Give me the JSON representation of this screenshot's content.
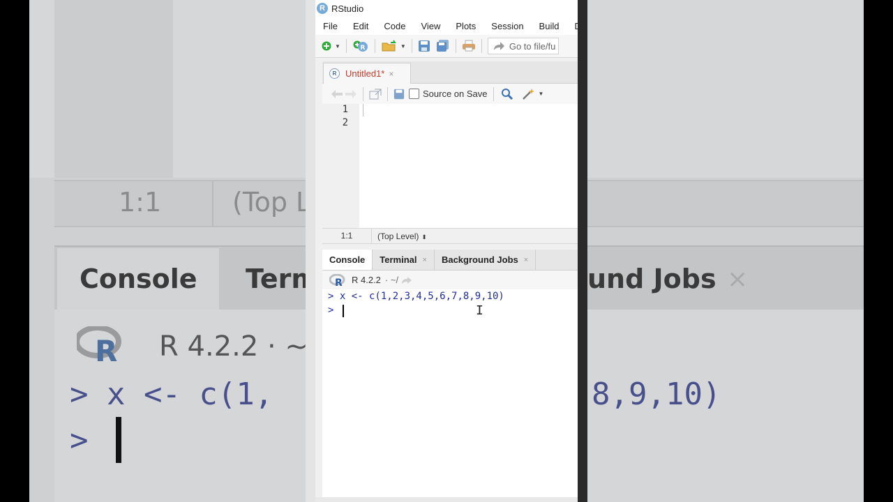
{
  "background": {
    "status_pos": "1:1",
    "status_scope": "(Top L",
    "tab_console": "Console",
    "tab_terminal": "Term",
    "tab_jobs": "und Jobs",
    "version": "R 4.2.2  ·  ~",
    "code_line1_left": "> x <- c(1,",
    "code_line1_right": "8,9,10)",
    "code_line2": "> "
  },
  "window": {
    "title": "RStudio",
    "app_icon_letter": "R"
  },
  "menu": [
    "File",
    "Edit",
    "Code",
    "View",
    "Plots",
    "Session",
    "Build",
    "D"
  ],
  "toolbar": {
    "goto_placeholder": "Go to file/fu"
  },
  "editor": {
    "tab_title": "Untitled1*",
    "tab_close": "×",
    "source_on_save": "Source on Save",
    "line_numbers": [
      "1",
      "2"
    ],
    "status_position": "1:1",
    "status_scope": "(Top Level)",
    "status_scope_arrows": "⬍"
  },
  "console": {
    "tabs": [
      {
        "label": "Console",
        "close": ""
      },
      {
        "label": "Terminal",
        "close": "×"
      },
      {
        "label": "Background Jobs",
        "close": "×"
      }
    ],
    "r_version": "R 4.2.2",
    "path": "·  ~/",
    "lines": [
      "> x <- c(1,2,3,4,5,6,7,8,9,10)",
      "> "
    ],
    "ibeam": "I"
  },
  "colors": {
    "console_text": "#1f2b9e",
    "modified_tab_title": "#c0392b",
    "r_blue": "#75aadb"
  }
}
